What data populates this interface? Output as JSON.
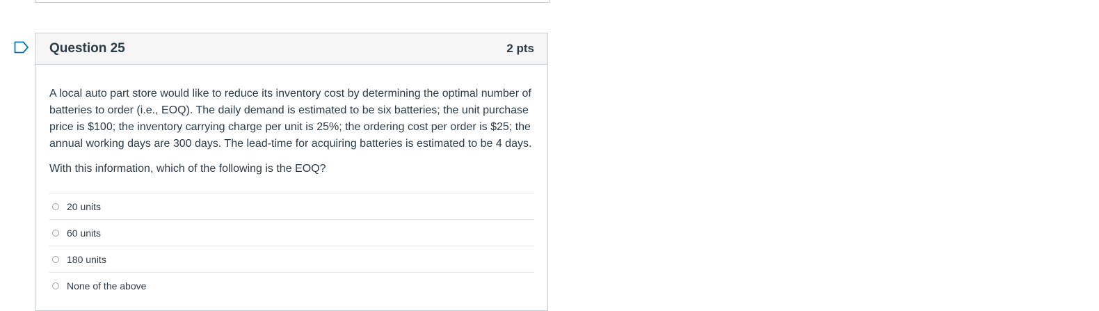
{
  "question": {
    "title": "Question 25",
    "points": "2 pts",
    "text": "A local auto part store would like to reduce its inventory cost by determining the optimal number of batteries to order (i.e., EOQ).  The daily demand is estimated to be six batteries; the unit purchase price is $100; the inventory carrying charge per unit is 25%; the ordering cost per order is $25; the annual working days are 300 days. The lead-time for acquiring batteries is estimated to be 4 days.",
    "prompt": "With this information, which of the following is the EOQ?",
    "answers": [
      {
        "label": "20 units"
      },
      {
        "label": "60 units"
      },
      {
        "label": "180 units"
      },
      {
        "label": "None of the above"
      }
    ]
  },
  "icons": {
    "flag": "bookmark-flag-icon",
    "radio": "radio-button"
  },
  "colors": {
    "accent": "#0374b5",
    "border": "#c7cdd1",
    "header_bg": "#f5f5f5",
    "text": "#2d3b45"
  }
}
